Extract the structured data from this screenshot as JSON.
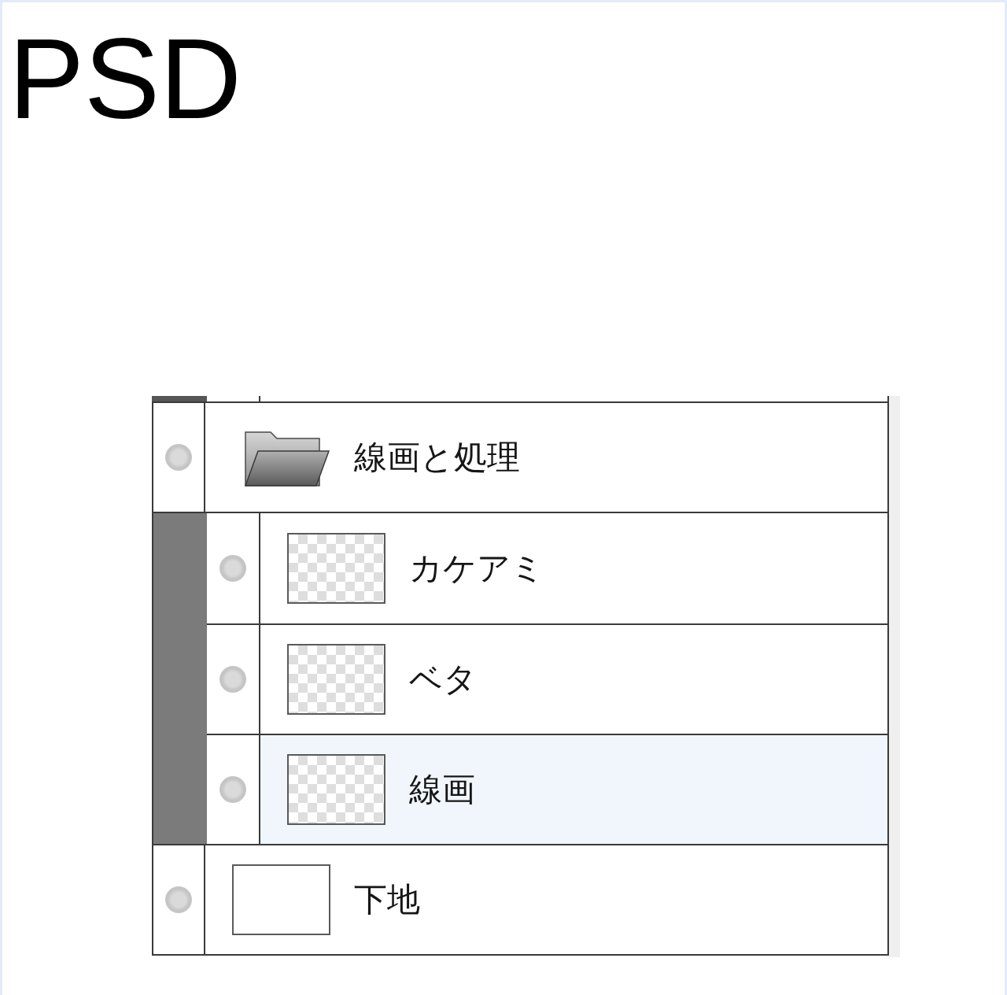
{
  "title": "PSD",
  "layers": [
    {
      "kind": "folder",
      "name": "線画と処理",
      "selected": false,
      "expanded": true,
      "children": [
        {
          "kind": "raster",
          "name": "カケアミ",
          "selected": false,
          "transparent": true
        },
        {
          "kind": "raster",
          "name": "ベタ",
          "selected": false,
          "transparent": true
        },
        {
          "kind": "raster",
          "name": "線画",
          "selected": true,
          "transparent": true
        }
      ]
    },
    {
      "kind": "raster",
      "name": "下地",
      "selected": false,
      "transparent": false
    }
  ]
}
